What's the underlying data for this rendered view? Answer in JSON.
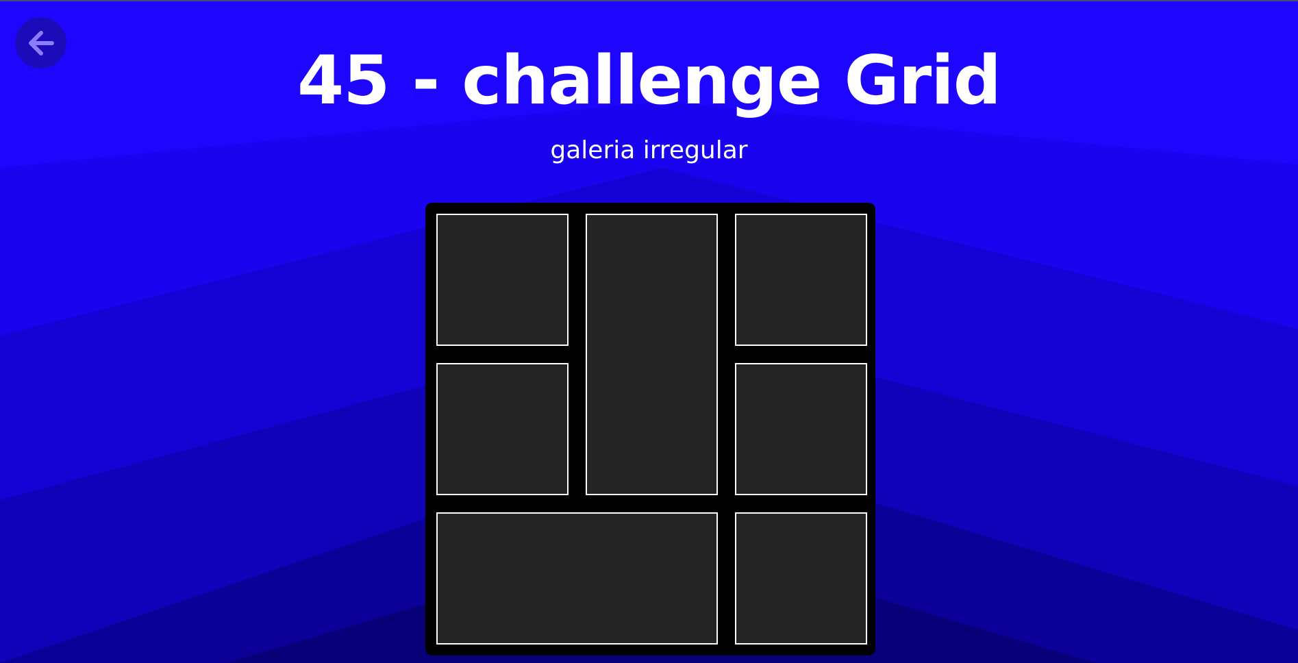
{
  "page": {
    "title": "45 - challenge Grid",
    "subtitle": "galeria irregular"
  },
  "back_button": {
    "icon": "arrow-left-icon"
  },
  "gallery": {
    "items": [
      {
        "name": "gallery-item-1"
      },
      {
        "name": "gallery-item-2-tall"
      },
      {
        "name": "gallery-item-3"
      },
      {
        "name": "gallery-item-4"
      },
      {
        "name": "gallery-item-5"
      },
      {
        "name": "gallery-item-6-wide"
      },
      {
        "name": "gallery-item-7"
      }
    ]
  },
  "colors": {
    "background_top": "#1e05fd",
    "background_bottom": "#060060",
    "back_button_bg": "#1c0bb8",
    "back_arrow": "#8a7dff",
    "gallery_bg": "#000000",
    "tile_fill": "#242424",
    "tile_border": "#ffffff",
    "text": "#ffffff"
  }
}
